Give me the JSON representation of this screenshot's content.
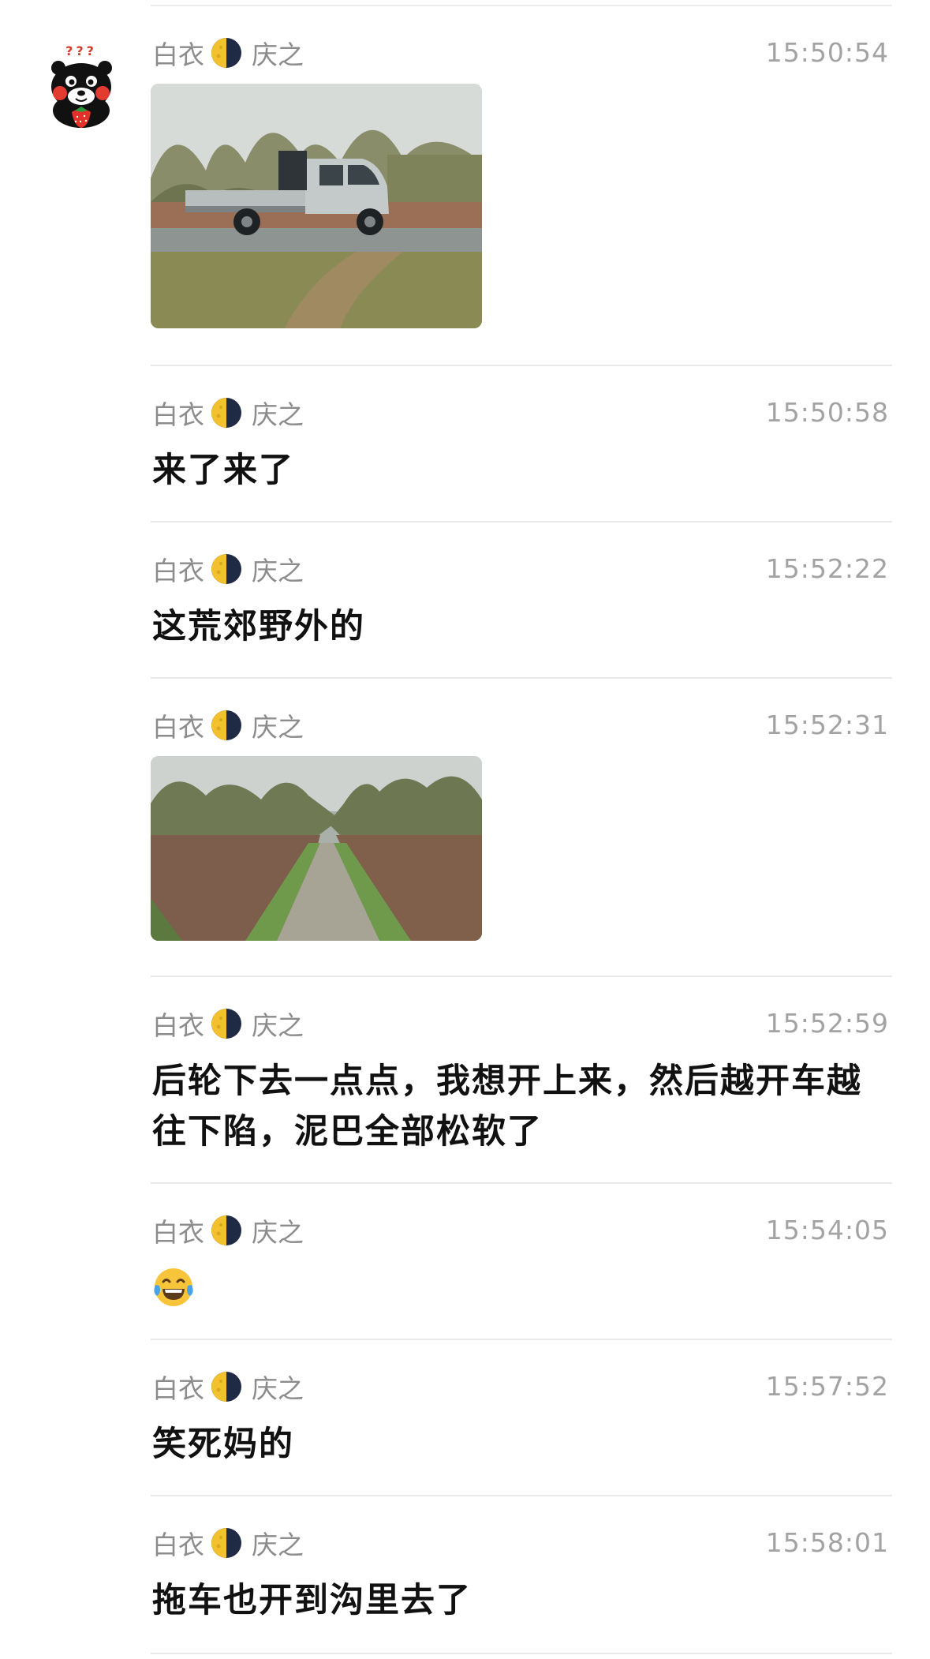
{
  "messages": [
    {
      "sender_first": "白衣",
      "sender_second": "庆之",
      "time": "15:50:54",
      "type": "image",
      "image_icon": "truck-photo"
    },
    {
      "sender_first": "白衣",
      "sender_second": "庆之",
      "time": "15:50:58",
      "type": "text",
      "text": "来了来了"
    },
    {
      "sender_first": "白衣",
      "sender_second": "庆之",
      "time": "15:52:22",
      "type": "text",
      "text": "这荒郊野外的"
    },
    {
      "sender_first": "白衣",
      "sender_second": "庆之",
      "time": "15:52:31",
      "type": "image",
      "image_icon": "muddy-road-photo"
    },
    {
      "sender_first": "白衣",
      "sender_second": "庆之",
      "time": "15:52:59",
      "type": "text",
      "text": "后轮下去一点点，我想开上来，然后越开车越往下陷，泥巴全部松软了"
    },
    {
      "sender_first": "白衣",
      "sender_second": "庆之",
      "time": "15:54:05",
      "type": "emoji",
      "emoji_icon": "tears-of-joy-emoji"
    },
    {
      "sender_first": "白衣",
      "sender_second": "庆之",
      "time": "15:57:52",
      "type": "text",
      "text": "笑死妈的"
    },
    {
      "sender_first": "白衣",
      "sender_second": "庆之",
      "time": "15:58:01",
      "type": "text",
      "text": "拖车也开到沟里去了"
    }
  ],
  "avatar": {
    "icon": "kumamon-avatar",
    "badge_text": "???"
  },
  "moon_icon": "half-moon-icon",
  "colors": {
    "sender": "#8c8c8c",
    "time": "#a3a3a3",
    "text": "#111111",
    "divider": "#e8e8e8",
    "moon_yellow": "#f2c12e",
    "moon_dark": "#1f2a44"
  }
}
